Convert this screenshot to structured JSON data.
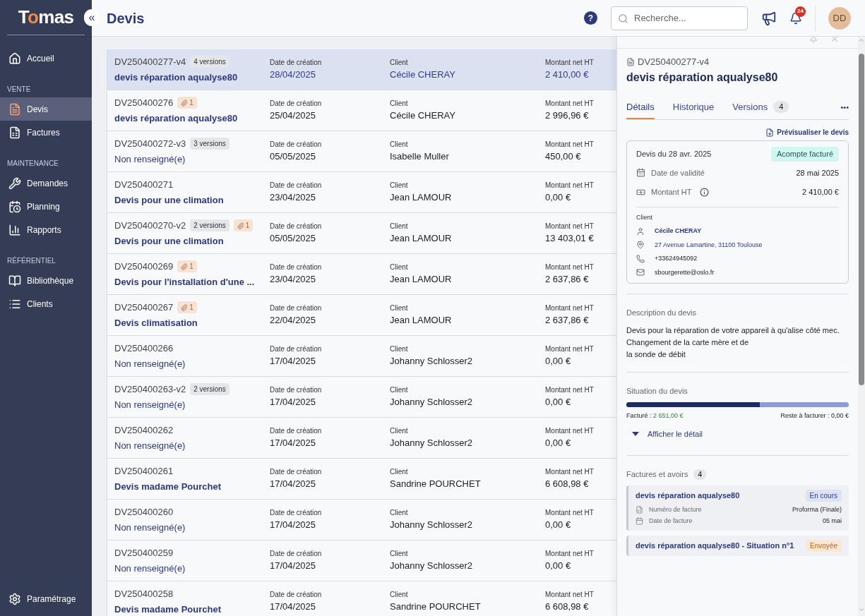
{
  "sidebar": {
    "logo": "Tomas",
    "items": [
      {
        "kind": "item",
        "label": "Accueil",
        "selected": false
      },
      {
        "kind": "section",
        "label": "VENTE"
      },
      {
        "kind": "item",
        "label": "Devis",
        "selected": true
      },
      {
        "kind": "item",
        "label": "Factures",
        "selected": false
      },
      {
        "kind": "section",
        "label": "MAINTENANCE"
      },
      {
        "kind": "item",
        "label": "Demandes",
        "selected": false
      },
      {
        "kind": "item",
        "label": "Planning",
        "selected": false
      },
      {
        "kind": "item",
        "label": "Rapports",
        "selected": false
      },
      {
        "kind": "section",
        "label": "RÉFÉRENTIEL"
      },
      {
        "kind": "item",
        "label": "Bibliothèque",
        "selected": false
      },
      {
        "kind": "item",
        "label": "Clients",
        "selected": false
      }
    ],
    "footer": {
      "label": "Paramétrage"
    }
  },
  "header": {
    "collapse": "«",
    "title": "Devis",
    "help": "?",
    "search": {
      "placeholder": "Recherche..."
    },
    "notifications": "24",
    "avatar": "DD"
  },
  "rows": [
    {
      "id": "DV250400277-v4",
      "badges": [
        {
          "kind": "versions",
          "text": "4 versions"
        }
      ],
      "title": "devis réparation aqualyse80",
      "missing": false,
      "date_label": "Date de création",
      "date": "28/04/2025",
      "client_label": "Client",
      "client": "Cécile CHERAY",
      "amount_label": "Montant net HT",
      "amount": "2 410,00 €",
      "selected": true
    },
    {
      "id": "DV250400276",
      "badges": [
        {
          "kind": "attachments",
          "text": "1"
        }
      ],
      "title": "devis réparation aqualyse80",
      "missing": false,
      "date_label": "Date de création",
      "date": "25/04/2025",
      "client_label": "Client",
      "client": "Cécile CHERAY",
      "amount_label": "Montant net HT",
      "amount": "2 996,96 €",
      "selected": false
    },
    {
      "id": "DV250400272-v3",
      "badges": [
        {
          "kind": "versions",
          "text": "3 versions"
        }
      ],
      "title": "Non renseigné(e)",
      "missing": true,
      "date_label": "Date de création",
      "date": "05/05/2025",
      "client_label": "Client",
      "client": "Isabelle Muller",
      "amount_label": "Montant net HT",
      "amount": "450,00 €",
      "selected": false
    },
    {
      "id": "DV250400271",
      "badges": [],
      "title": "Devis pour une climation",
      "missing": false,
      "date_label": "Date de création",
      "date": "23/04/2025",
      "client_label": "Client",
      "client": "Jean LAMOUR",
      "amount_label": "Montant net HT",
      "amount": "0,00 €",
      "selected": false
    },
    {
      "id": "DV250400270-v2",
      "badges": [
        {
          "kind": "versions",
          "text": "2 versions"
        },
        {
          "kind": "attachments",
          "text": "1"
        }
      ],
      "title": "Devis pour une climation",
      "missing": false,
      "date_label": "Date de création",
      "date": "05/05/2025",
      "client_label": "Client",
      "client": "Jean LAMOUR",
      "amount_label": "Montant net HT",
      "amount": "13 403,01 €",
      "selected": false
    },
    {
      "id": "DV250400269",
      "badges": [
        {
          "kind": "attachments",
          "text": "1"
        }
      ],
      "title": "Devis pour l'installation d'une ...",
      "missing": false,
      "date_label": "Date de création",
      "date": "23/04/2025",
      "client_label": "Client",
      "client": "Jean LAMOUR",
      "amount_label": "Montant net HT",
      "amount": "2 637,86 €",
      "selected": false
    },
    {
      "id": "DV250400267",
      "badges": [
        {
          "kind": "attachments",
          "text": "1"
        }
      ],
      "title": "Devis climatisation",
      "missing": false,
      "date_label": "Date de création",
      "date": "22/04/2025",
      "client_label": "Client",
      "client": "Jean LAMOUR",
      "amount_label": "Montant net HT",
      "amount": "2 637,86 €",
      "selected": false
    },
    {
      "id": "DV250400266",
      "badges": [],
      "title": "Non renseigné(e)",
      "missing": true,
      "date_label": "Date de création",
      "date": "17/04/2025",
      "client_label": "Client",
      "client": "Johanny Schlosser2",
      "amount_label": "Montant net HT",
      "amount": "0,00 €",
      "selected": false
    },
    {
      "id": "DV250400263-v2",
      "badges": [
        {
          "kind": "versions",
          "text": "2 versions"
        }
      ],
      "title": "Non renseigné(e)",
      "missing": true,
      "date_label": "Date de création",
      "date": "17/04/2025",
      "client_label": "Client",
      "client": "Johanny Schlosser2",
      "amount_label": "Montant net HT",
      "amount": "0,00 €",
      "selected": false
    },
    {
      "id": "DV250400262",
      "badges": [],
      "title": "Non renseigné(e)",
      "missing": true,
      "date_label": "Date de création",
      "date": "17/04/2025",
      "client_label": "Client",
      "client": "Johanny Schlosser2",
      "amount_label": "Montant net HT",
      "amount": "0,00 €",
      "selected": false
    },
    {
      "id": "DV250400261",
      "badges": [],
      "title": "Devis madame Pourchet",
      "missing": false,
      "date_label": "Date de création",
      "date": "17/04/2025",
      "client_label": "Client",
      "client": "Sandrine POURCHET",
      "amount_label": "Montant net HT",
      "amount": "6 608,98 €",
      "selected": false
    },
    {
      "id": "DV250400260",
      "badges": [],
      "title": "Non renseigné(e)",
      "missing": true,
      "date_label": "Date de création",
      "date": "17/04/2025",
      "client_label": "Client",
      "client": "Johanny Schlosser2",
      "amount_label": "Montant net HT",
      "amount": "0,00 €",
      "selected": false
    },
    {
      "id": "DV250400259",
      "badges": [],
      "title": "Non renseigné(e)",
      "missing": true,
      "date_label": "Date de création",
      "date": "17/04/2025",
      "client_label": "Client",
      "client": "Johanny Schlosser2",
      "amount_label": "Montant net HT",
      "amount": "0,00 €",
      "selected": false
    },
    {
      "id": "DV250400258",
      "badges": [],
      "title": "Devis madame Pourchet",
      "missing": false,
      "date_label": "Date de création",
      "date": "17/04/2025",
      "client_label": "Client",
      "client": "Sandrine POURCHET",
      "amount_label": "Montant net HT",
      "amount": "6 608,98 €",
      "selected": false
    }
  ],
  "panel": {
    "id": "DV250400277-v4",
    "title": "devis réparation aqualyse80",
    "tabs": [
      {
        "label": "Détails",
        "selected": true
      },
      {
        "label": "Historique",
        "selected": false
      },
      {
        "label": "Versions",
        "count": "4",
        "selected": false
      }
    ],
    "more": "•••",
    "preview": "Prévisualiser le devis",
    "summary": {
      "heading": "Devis du 28 avr. 2025",
      "status": "Acompte facturé",
      "validity_label": "Date de validité",
      "validity": "28 mai 2025",
      "amount_label": "Montant HT",
      "amount": "2 410,00 €",
      "client_label": "Client",
      "client": "Cécile CHERAY",
      "address": "27 Avenue Lamartine, 31100 Toulouse",
      "phone": "+33624945092",
      "email": "sbourgerette@oslo.fr"
    },
    "description": {
      "label": "Description du devis",
      "lines": [
        "Devis pour la réparation de votre appareil à qu'alise côté mec.",
        "Changement de la carte mère et de",
        "la sonde de débit"
      ]
    },
    "situation": {
      "label": "Situation du devis",
      "level": 0.6,
      "billed_label": "Facturé :",
      "billed": "2 651,00 €",
      "remaining": "Reste à facturer : 0,00 €",
      "toggle": "Afficher le détail"
    },
    "invoices": {
      "label": "Factures et avoirs",
      "count": "4",
      "items": [
        {
          "title": "devis réparation aqualyse80",
          "status": "En cours",
          "kind": "progress",
          "number_label": "Numéro de facture",
          "number": "Proforma (Finale)",
          "date_label": "Date de facture",
          "date": "05 mai"
        },
        {
          "title": "devis réparation aqualyse80 - Situation n°1",
          "status": "Envoyée",
          "kind": "sent"
        }
      ]
    }
  }
}
